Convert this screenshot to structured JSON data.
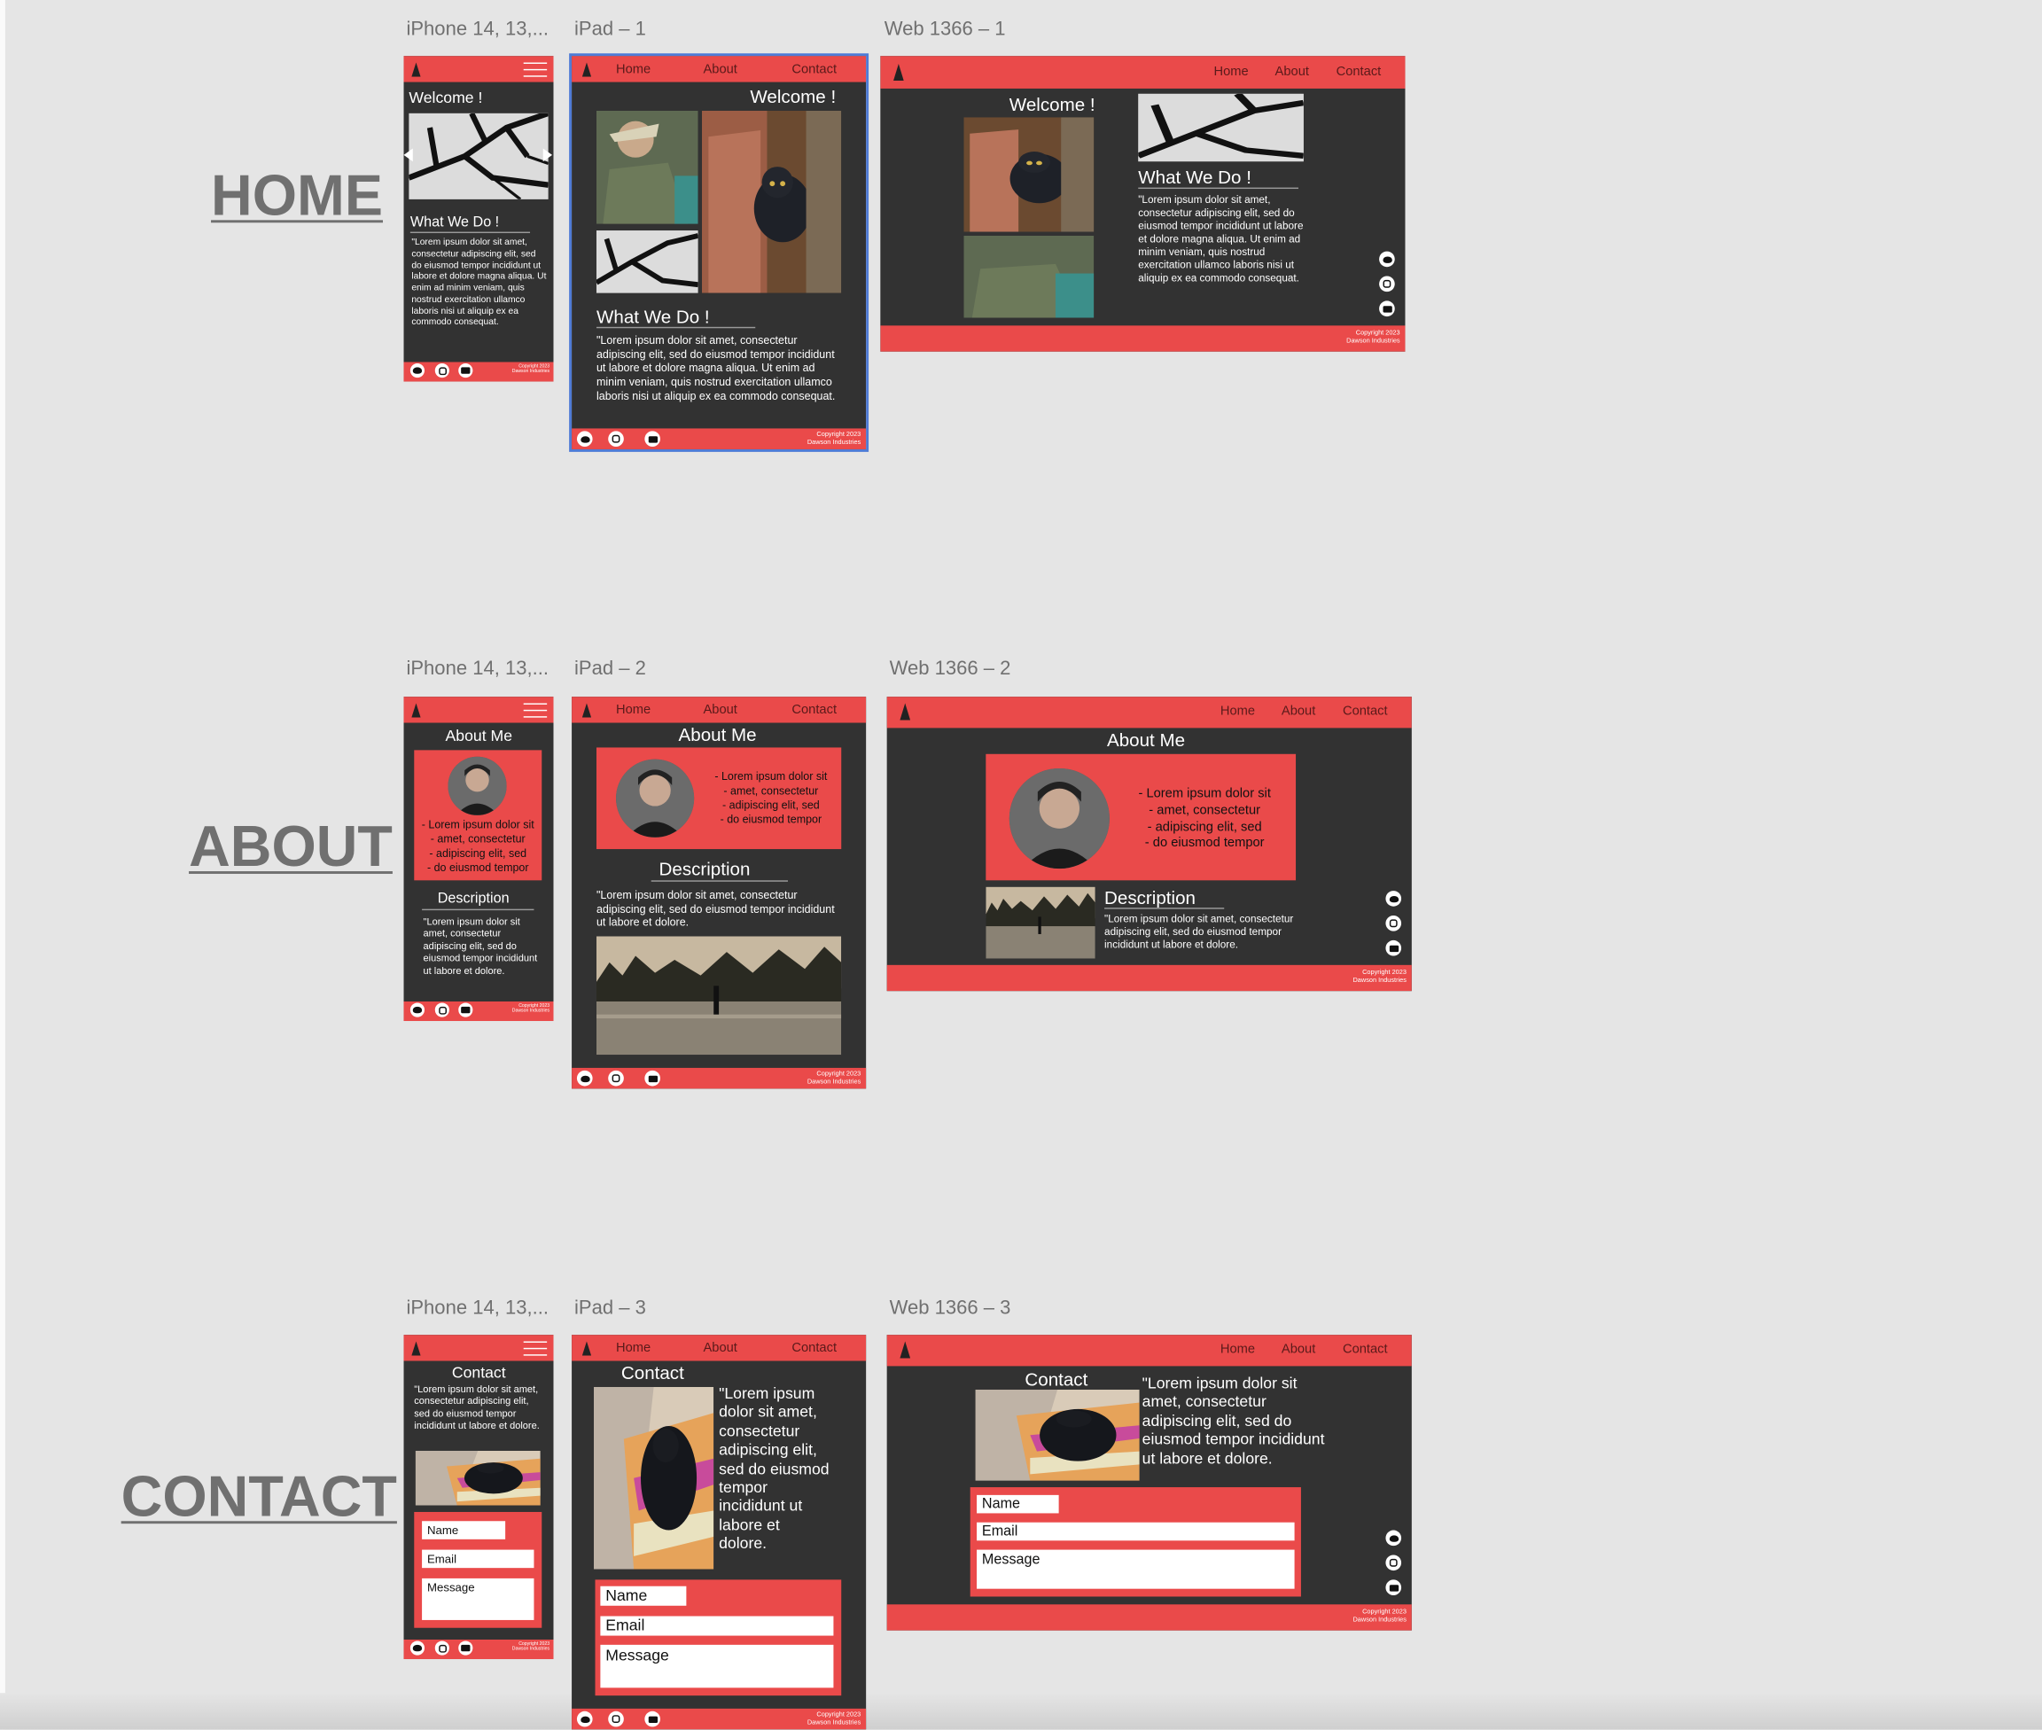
{
  "frame_labels": {
    "iphone_home": "iPhone 14, 13,...",
    "ipad_home": "iPad – 1",
    "web_home": "Web 1366 – 1",
    "iphone_about": "iPhone 14, 13,...",
    "ipad_about": "iPad – 2",
    "web_about": "Web 1366 – 2",
    "iphone_contact": "iPhone 14, 13,...",
    "ipad_contact": "iPad – 3",
    "web_contact": "Web 1366 – 3"
  },
  "sections": {
    "home": "HOME",
    "about": "ABOUT",
    "contact": "CONTACT"
  },
  "nav": {
    "home": "Home",
    "about": "About",
    "contact": "Contact"
  },
  "home": {
    "welcome_mobile": "Welcome !",
    "welcome": "Welcome !",
    "what_we_do": "What We Do !",
    "lorem_mobile": "\"Lorem ipsum dolor sit amet, consectetur adipiscing elit, sed do eiusmod tempor incididunt ut labore et dolore magna aliqua. Ut enim ad minim veniam, quis nostrud exercitation ullamco laboris nisi ut aliquip ex ea commodo consequat.",
    "lorem": "\"Lorem ipsum dolor sit amet, consectetur adipiscing elit, sed do eiusmod tempor incididunt ut labore et dolore magna aliqua. Ut enim ad minim veniam, quis nostrud exercitation ullamco laboris nisi ut aliquip ex ea commodo consequat."
  },
  "about": {
    "title": "About Me",
    "bullets": [
      "- Lorem ipsum dolor sit",
      "- amet, consectetur",
      "- adipiscing elit, sed",
      "- do eiusmod tempor"
    ],
    "description_title": "Description",
    "description": "\"Lorem ipsum dolor sit amet, consectetur adipiscing elit, sed do eiusmod tempor incididunt ut labore et dolore."
  },
  "contact": {
    "title": "Contact",
    "lorem": "\"Lorem ipsum dolor sit amet, consectetur adipiscing elit, sed do eiusmod tempor incididunt ut labore et dolore.",
    "name_placeholder": "Name",
    "email_placeholder": "Email",
    "message_placeholder": "Message"
  },
  "footer": {
    "copyright": "Copyright 2023",
    "company": "Dawson Industries"
  },
  "icons": [
    "app-logo-icon",
    "hamburger-menu-icon",
    "twitter-icon",
    "instagram-icon",
    "youtube-icon",
    "carousel-prev-icon",
    "carousel-next-icon"
  ],
  "colors": {
    "canvas": "#e5e5e5",
    "frame_bg": "#323232",
    "accent_red": "#ea4a4a",
    "nav_text": "#5a1a1a",
    "selection": "#4f7bd6"
  }
}
